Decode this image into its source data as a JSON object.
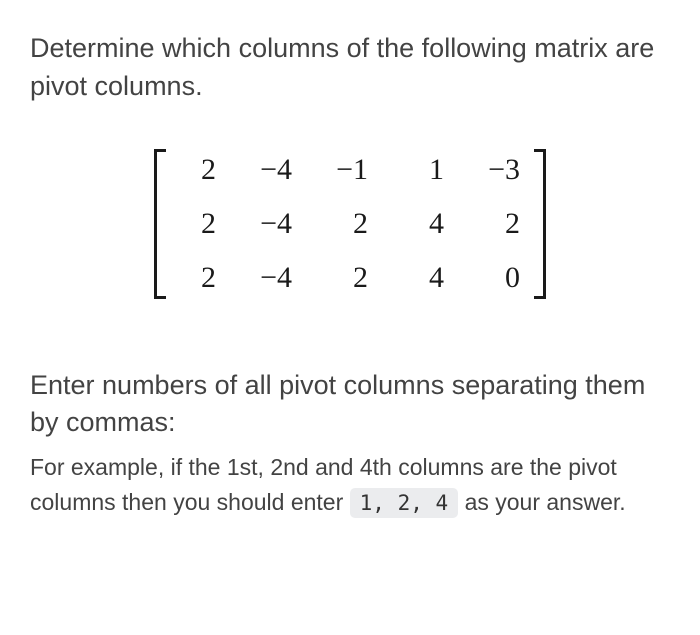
{
  "question": {
    "prompt": "Determine which columns of the following matrix are pivot columns."
  },
  "chart_data": {
    "type": "table",
    "title": "matrix",
    "rows": 3,
    "cols": 5,
    "values": [
      [
        "2",
        "−4",
        "−1",
        "1",
        "−3"
      ],
      [
        "2",
        "−4",
        "2",
        "4",
        "2"
      ],
      [
        "2",
        "−4",
        "2",
        "4",
        "0"
      ]
    ]
  },
  "instruction": {
    "main": "Enter numbers of all pivot columns separating them by commas:",
    "example_pre": "For example, if the 1st, 2nd and 4th columns are the pivot columns then you should enter",
    "example_code": "1, 2, 4",
    "example_post": "as your answer."
  }
}
